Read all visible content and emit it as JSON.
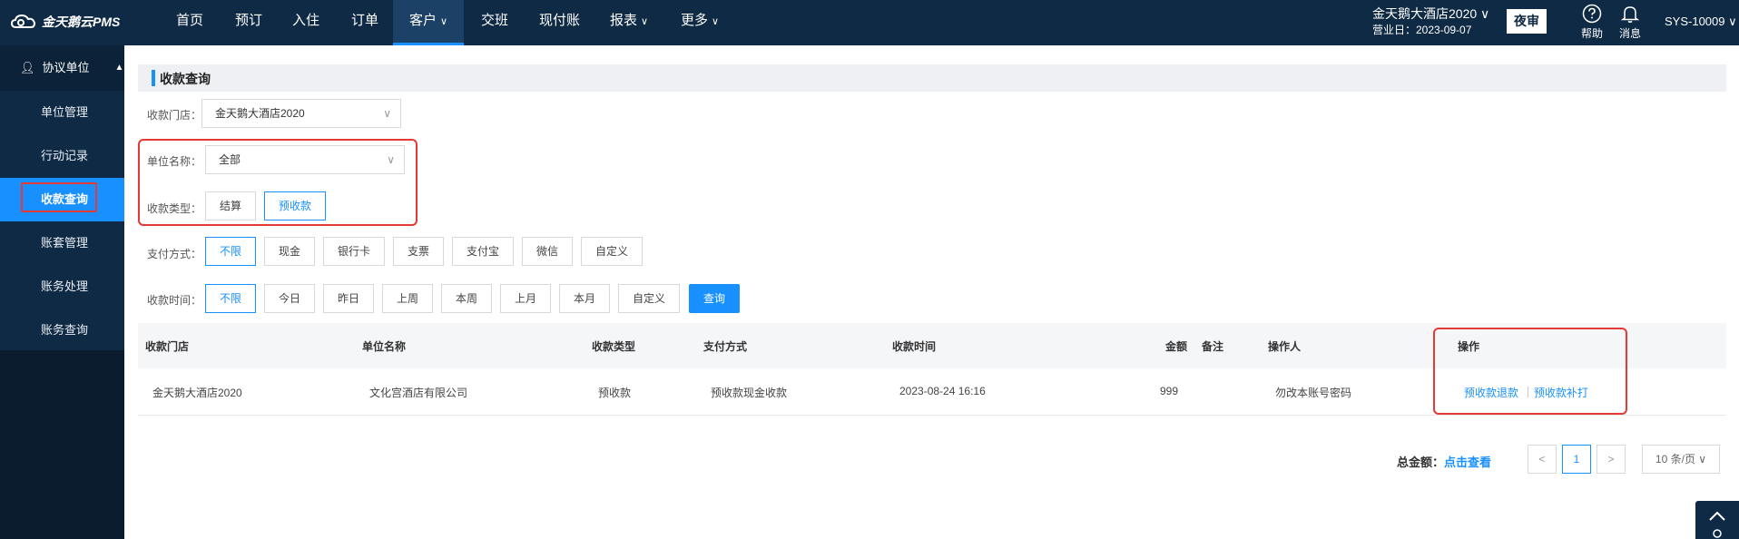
{
  "brand": {
    "name": "金天鹅云PMS"
  },
  "nav": {
    "items": [
      {
        "label": "首页",
        "caret": ""
      },
      {
        "label": "预订",
        "caret": ""
      },
      {
        "label": "入住",
        "caret": ""
      },
      {
        "label": "订单",
        "caret": ""
      },
      {
        "label": "客户",
        "caret": "∨"
      },
      {
        "label": "交班",
        "caret": ""
      },
      {
        "label": "现付账",
        "caret": ""
      },
      {
        "label": "报表",
        "caret": "∨"
      },
      {
        "label": "更多",
        "caret": "∨"
      }
    ],
    "active_index": 4
  },
  "header": {
    "hotel_name": "金天鹅大酒店2020 ∨",
    "business_date": "营业日：2023-09-07",
    "night_audit": "夜审",
    "help": "帮助",
    "messages": "消息",
    "user": "SYS-10009 ∨"
  },
  "sidebar": {
    "group": "协议单位",
    "items": [
      {
        "label": "单位管理"
      },
      {
        "label": "行动记录"
      },
      {
        "label": "收款查询"
      },
      {
        "label": "账套管理"
      },
      {
        "label": "账务处理"
      },
      {
        "label": "账务查询"
      }
    ],
    "active_index": 2
  },
  "page": {
    "title": "收款查询",
    "store_label": "收款门店：",
    "store_value": "金天鹅大酒店2020",
    "unit_label": "单位名称：",
    "unit_value": "全部",
    "type_label": "收款类型：",
    "types": [
      "结算",
      "预收款"
    ],
    "pay_label": "支付方式：",
    "pay_methods": [
      "不限",
      "现金",
      "银行卡",
      "支票",
      "支付宝",
      "微信",
      "自定义"
    ],
    "time_label": "收款时间：",
    "times": [
      "不限",
      "今日",
      "昨日",
      "上周",
      "本周",
      "上月",
      "本月",
      "自定义"
    ],
    "query_button": "查询"
  },
  "table": {
    "columns": [
      "收款门店",
      "单位名称",
      "收款类型",
      "支付方式",
      "收款时间",
      "金额",
      "备注",
      "操作人",
      "操作"
    ],
    "rows": [
      {
        "store": "金天鹅大酒店2020",
        "unit": "文化宫酒店有限公司",
        "type": "预收款",
        "method": "预收款现金收款",
        "time": "2023-08-24 16:16",
        "amount": "999",
        "remark": "",
        "operator": "勿改本账号密码",
        "actions": [
          "预收款退款",
          "预收款补打"
        ]
      }
    ]
  },
  "pagination": {
    "total_label": "总金额：",
    "total_link": "点击查看",
    "prev": "<",
    "current": "1",
    "next": ">",
    "page_size": "10 条/页 ∨"
  },
  "float": {
    "up_icon": "^"
  }
}
